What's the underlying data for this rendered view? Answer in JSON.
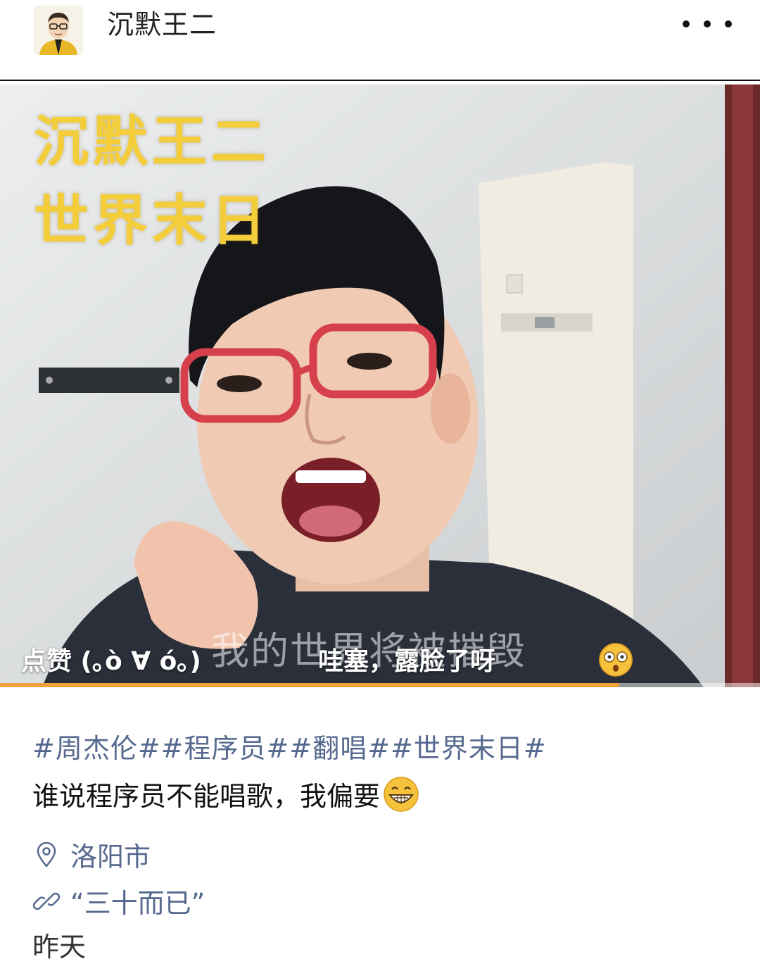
{
  "header": {
    "username": "沉默王二",
    "more_label": "更多"
  },
  "video": {
    "overlay_title_line1": "沉默王二",
    "overlay_title_line2": "世界末日",
    "burned_subtitle": "我的世界将被摧毁",
    "danmaku_left": "点赞 (｡ò ∀ ó｡)",
    "danmaku_mid": "哇塞，露脸了呀",
    "emoji_icons": [
      "shocked-face-icon",
      "shocked-face-icon",
      "shocked-face-icon"
    ],
    "progress_fraction": 0.815,
    "progress_color": "#f0a13c",
    "overlay_title_color": "#f4cd3a"
  },
  "post": {
    "tags": "#周杰伦##程序员##翻唱##世界末日#",
    "caption": "谁说程序员不能唱歌，我偏要",
    "caption_emoji": "grin-face-icon",
    "location": "洛阳市",
    "link": "“三十而已”",
    "time": "昨天"
  },
  "colors": {
    "link_blue": "#56698f",
    "text": "#111111"
  }
}
